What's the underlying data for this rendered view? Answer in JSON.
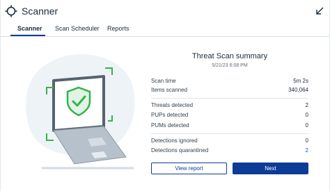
{
  "app": {
    "title": "Scanner"
  },
  "tabs": [
    {
      "label": "Scanner",
      "active": true
    },
    {
      "label": "Scan Scheduler",
      "active": false
    },
    {
      "label": "Reports",
      "active": false
    }
  ],
  "summary": {
    "title": "Threat Scan summary",
    "date": "5/21/23 6:08 PM",
    "group1": [
      {
        "label": "Scan time",
        "value": "5m 2s"
      },
      {
        "label": "Items scanned",
        "value": "340,064"
      }
    ],
    "group2": [
      {
        "label": "Threats detected",
        "value": "2"
      },
      {
        "label": "PUPs detected",
        "value": "0"
      },
      {
        "label": "PUMs detected",
        "value": "0"
      }
    ],
    "group3": [
      {
        "label": "Detections ignored",
        "value": "0"
      },
      {
        "label": "Detections quarantined",
        "value": "2"
      }
    ]
  },
  "buttons": {
    "view_report": "View report",
    "next": "Next"
  },
  "colors": {
    "accent": "#0d3c97",
    "link": "#0d57c5",
    "shield": "#35b24a"
  }
}
